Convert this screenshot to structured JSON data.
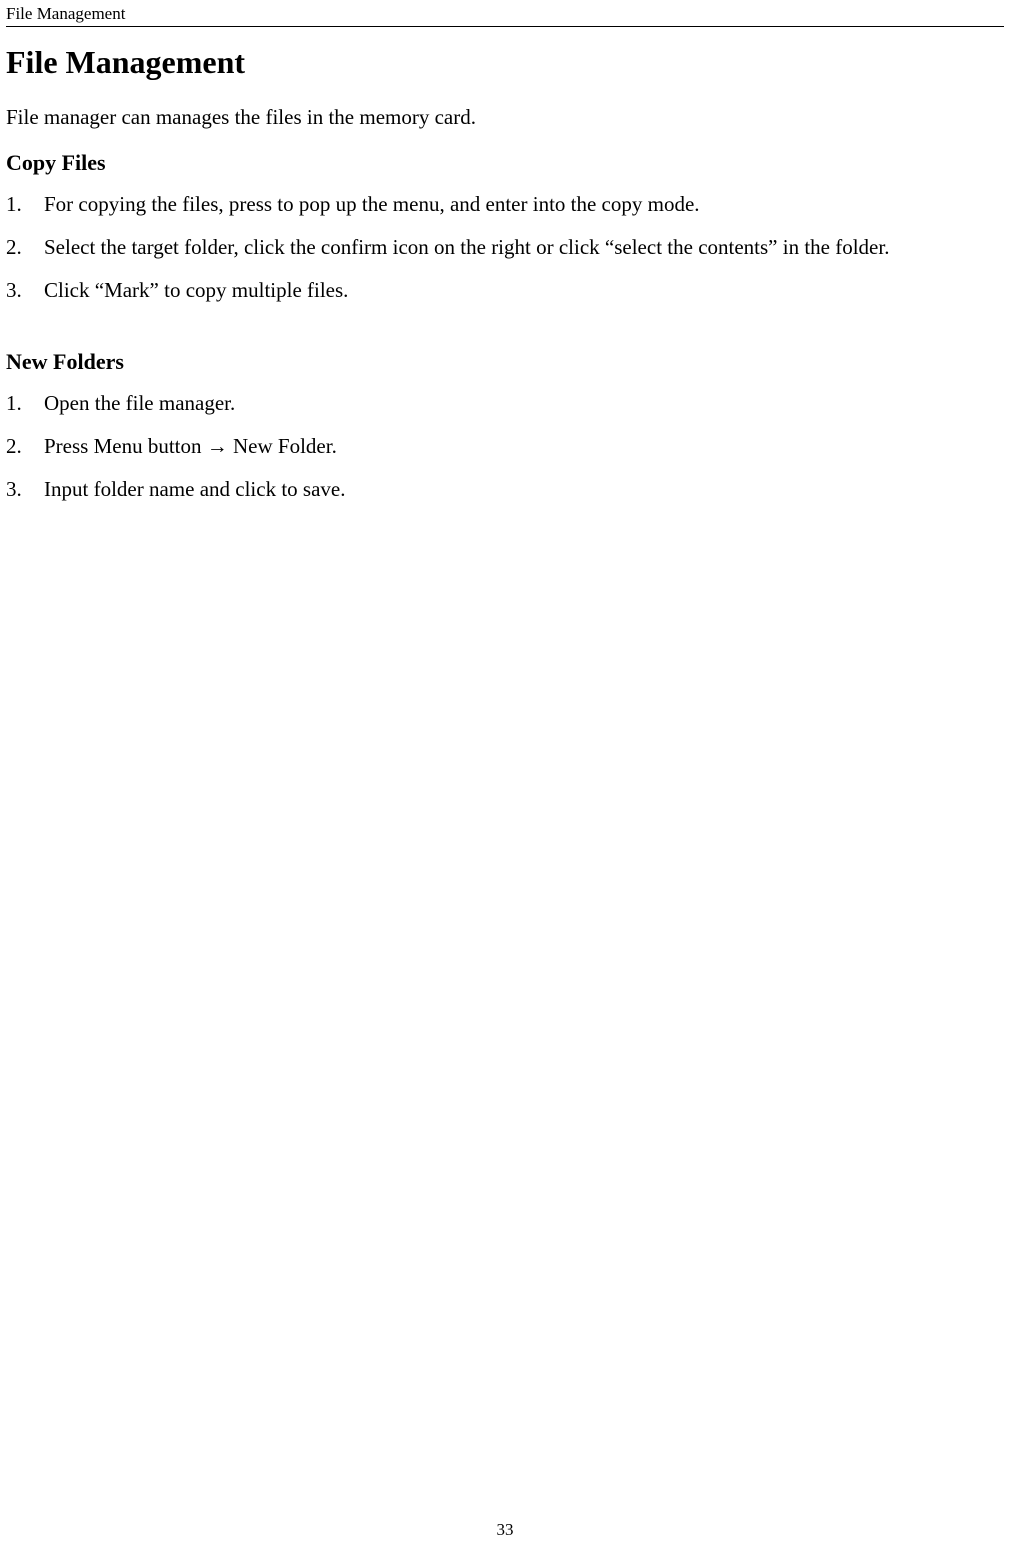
{
  "header": {
    "title": "File Management"
  },
  "main": {
    "heading": "File Management",
    "intro": "File manager can manages the files in the memory card.",
    "sections": [
      {
        "heading": "Copy Files",
        "items": [
          {
            "num": "1.",
            "text": "For copying the files, press to pop up the menu, and enter into the copy mode."
          },
          {
            "num": "2.",
            "text": "Select the target folder, click the confirm icon on the right or click “select the contents” in the folder."
          },
          {
            "num": "3.",
            "text": "Click “Mark” to copy multiple files."
          }
        ]
      },
      {
        "heading": "New Folders",
        "items": [
          {
            "num": "1.",
            "text": "Open the file manager."
          },
          {
            "num": "2.",
            "text": "Press Menu button → New Folder."
          },
          {
            "num": "3.",
            "text": "Input folder name and click to save."
          }
        ]
      }
    ]
  },
  "footer": {
    "page_number": "33"
  }
}
